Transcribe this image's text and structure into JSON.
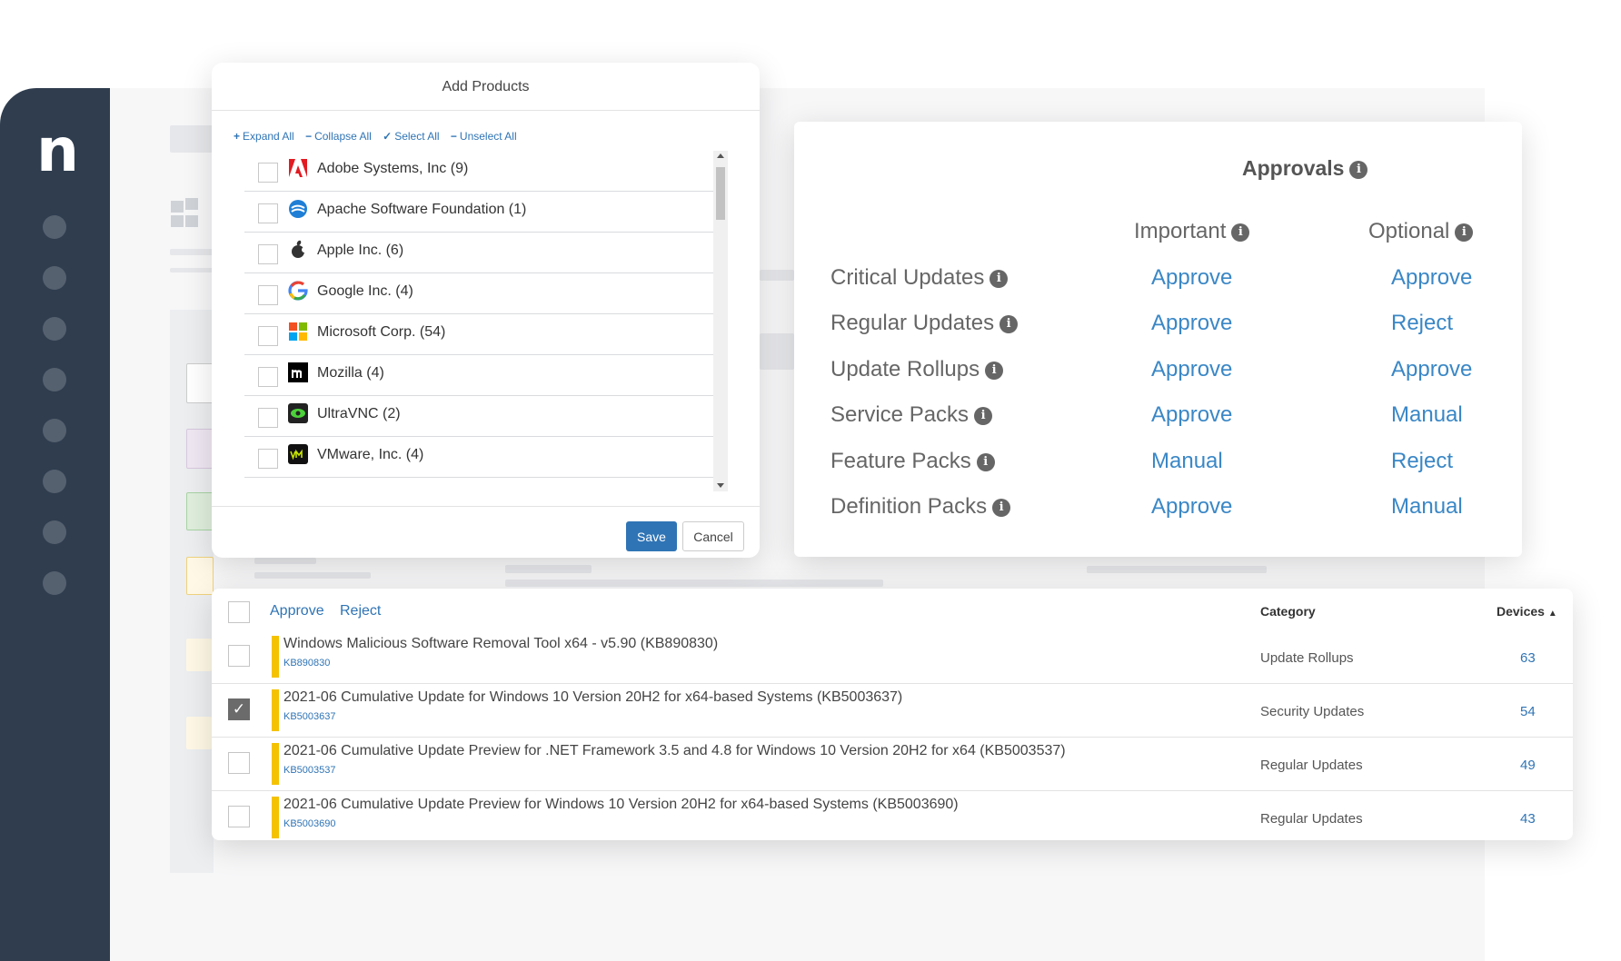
{
  "brand": {
    "logo_letter": "n",
    "accent": "#2f74b5",
    "sidebar_color": "#2f3d4f",
    "highlight_bar": "#f4c200"
  },
  "add_products": {
    "title": "Add Products",
    "toolbar": [
      {
        "icon": "+",
        "label": "Expand All"
      },
      {
        "icon": "−",
        "label": "Collapse All"
      },
      {
        "icon": "✓",
        "label": "Select All"
      },
      {
        "icon": "−",
        "label": "Unselect All"
      }
    ],
    "products": [
      {
        "name": "Adobe Systems, Inc (9)",
        "icon": "adobe-icon"
      },
      {
        "name": "Apache Software Foundation (1)",
        "icon": "apache-icon"
      },
      {
        "name": "Apple Inc. (6)",
        "icon": "apple-icon"
      },
      {
        "name": "Google Inc. (4)",
        "icon": "google-icon"
      },
      {
        "name": "Microsoft Corp. (54)",
        "icon": "microsoft-icon"
      },
      {
        "name": "Mozilla (4)",
        "icon": "mozilla-icon"
      },
      {
        "name": "UltraVNC (2)",
        "icon": "ultravnc-icon"
      },
      {
        "name": "VMware, Inc. (4)",
        "icon": "vmware-icon"
      }
    ],
    "save_label": "Save",
    "cancel_label": "Cancel"
  },
  "approvals": {
    "title": "Approvals",
    "columns": [
      "Important",
      "Optional"
    ],
    "rows": [
      {
        "label": "Critical Updates",
        "important": "Approve",
        "optional": "Approve"
      },
      {
        "label": "Regular Updates",
        "important": "Approve",
        "optional": "Reject"
      },
      {
        "label": "Update Rollups",
        "important": "Approve",
        "optional": "Approve"
      },
      {
        "label": "Service Packs",
        "important": "Approve",
        "optional": "Manual"
      },
      {
        "label": "Feature Packs",
        "important": "Manual",
        "optional": "Reject"
      },
      {
        "label": "Definition Packs",
        "important": "Approve",
        "optional": "Manual"
      }
    ]
  },
  "updates": {
    "header": {
      "approve_label": "Approve",
      "reject_label": "Reject",
      "category_label": "Category",
      "devices_label": "Devices",
      "sort_indicator": "▲"
    },
    "rows": [
      {
        "title": "Windows Malicious Software Removal Tool x64 - v5.90 (KB890830)",
        "kb": "KB890830",
        "category": "Update Rollups",
        "devices": "63",
        "checked": false
      },
      {
        "title": "2021-06 Cumulative Update for Windows 10 Version 20H2 for x64-based Systems (KB5003637)",
        "kb": "KB5003637",
        "category": "Security Updates",
        "devices": "54",
        "checked": true
      },
      {
        "title": "2021-06 Cumulative Update Preview for .NET Framework 3.5 and 4.8 for Windows 10 Version 20H2 for x64 (KB5003537)",
        "kb": "KB5003537",
        "category": "Regular Updates",
        "devices": "49",
        "checked": false
      },
      {
        "title": "2021-06 Cumulative Update Preview for Windows 10 Version 20H2 for x64-based Systems (KB5003690)",
        "kb": "KB5003690",
        "category": "Regular Updates",
        "devices": "43",
        "checked": false
      }
    ]
  }
}
